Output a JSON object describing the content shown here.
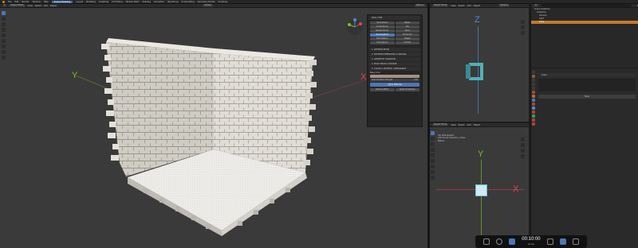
{
  "menu": {
    "items": [
      "File",
      "Edit",
      "Render",
      "Window",
      "Help"
    ],
    "active_workspace": "Scene Modeling",
    "workspaces": [
      "Layout",
      "Modeling",
      "Sculpting",
      "UV Editing",
      "Texture Paint",
      "Shading",
      "Animation",
      "Rendering",
      "Compositing",
      "Geometry Nodes",
      "Scripting"
    ]
  },
  "main_viewport": {
    "mode": "Object Mode",
    "header_items": [
      "View",
      "Select",
      "Add",
      "Object"
    ],
    "transform": "Global",
    "options_label": "Options",
    "axes": {
      "y": "Y",
      "x": "X"
    }
  },
  "addon_panel": {
    "wall_type_header": "WALL TYPE",
    "wall_types": [
      "Stone Bricks",
      "Plaster",
      "Cinder Blocks",
      "Tile",
      "Stacked Bricks",
      "Wood",
      "Running Bond",
      "Horizontal",
      "Brick Pattern",
      "Basket",
      "Herringbone",
      "Checker"
    ],
    "wall_types_selected": "Running Bond",
    "sections": [
      "1. PATTERN SETUP",
      "2. PATTERN DIMENSIONS & SPACING",
      "3. GEOMETRY VARIATION",
      "4. EDGE WEAR & DAMAGE",
      "5. COLOR & MATERIAL APPEARANCE"
    ],
    "base_color_label": "Base Color",
    "color_variation_label": "Color Variation Strength",
    "color_variation_value": "0.10",
    "apply_button": "Apply Material",
    "footer_buttons": [
      "Remove Effect",
      "Reset All Settings"
    ]
  },
  "top_right_viewport": {
    "mode": "Object Mode",
    "header_items": [
      "View",
      "Select",
      "Add",
      "Object"
    ],
    "options_label": "Options",
    "axis_z": "Z"
  },
  "bottom_right_viewport": {
    "mode": "Object Mode",
    "header_items": [
      "View",
      "Select",
      "Add",
      "Object"
    ],
    "info_lines": [
      "Top Orthographic",
      "(24) Scene Collection | Cube",
      "Meters"
    ],
    "axes": {
      "y": "Y",
      "x": "X"
    }
  },
  "outliner": {
    "search_placeholder": "",
    "rows": [
      {
        "label": "Scene Collection",
        "selected": false
      },
      {
        "label": "Collection",
        "selected": false
      },
      {
        "label": "Camera",
        "selected": false
      },
      {
        "label": "Light",
        "selected": false
      },
      {
        "label": "Cube",
        "selected": true
      }
    ]
  },
  "properties": {
    "section_label": "Cube",
    "new_button": "New"
  },
  "taskbar": {
    "time": "00:10:00",
    "fps": "24 fps"
  },
  "colors": {
    "accent": "#4d77b5",
    "selection_orange": "#c17a2b",
    "axis_x": "#e04550",
    "axis_y": "#7bbf2a",
    "axis_z": "#4a8de0",
    "brick": "#d9d6cf",
    "floor": "#e8e6e2",
    "base_color_swatch": "#a39180"
  }
}
